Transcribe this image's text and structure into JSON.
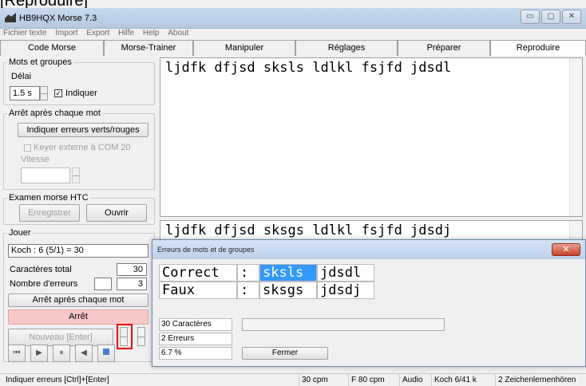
{
  "caption": "[Reproduire]",
  "window": {
    "title": "HB9HQX Morse 7.3",
    "minimize": "▭",
    "maximize": "▢",
    "close": "✕"
  },
  "menu": [
    "Fichier texte",
    "Import",
    "Export",
    "Hilfe",
    "Help",
    "About"
  ],
  "tabs": [
    "Code Morse",
    "Morse-Trainer",
    "Manipuler",
    "Réglages",
    "Préparer",
    "Reproduire"
  ],
  "left": {
    "mots_groupes": {
      "legend": "Mots et groupes",
      "delai_label": "Délai",
      "delai_value": "1.5 s",
      "indiquer_label": "Indiquer"
    },
    "arret": {
      "legend": "Arrêt après chaque mot",
      "btn_erreurs": "Indiquer erreurs verts/rouges",
      "keyer_label": "Keyer externe à COM 20",
      "vitesse_label": "Vitesse"
    },
    "examen": {
      "legend": "Examen morse HTC",
      "enregistrer": "Enregistrer",
      "ouvrir": "Ouvrir"
    },
    "jouer": {
      "legend": "Jouer",
      "koch_value": "Koch : 6 (5/1) = 30",
      "caracteres_label": "Caractères total",
      "caracteres_value": "30",
      "erreurs_label": "Nombre d'erreurs",
      "erreurs_value": "3",
      "arret_btn": "Arrêt après chaque mot",
      "arret_status": "Arrêt",
      "nouveau_btn": "Nouveau  [Enter]"
    }
  },
  "text": {
    "reference": "ljdfk dfjsd sksls ldlkl fsjfd jdsdl",
    "typed": "ljdfk dfjsd sksgs ldlkl fsjfd jdsdj"
  },
  "dialog": {
    "title": "Erreurs de mots et de groupes",
    "correct_label": "Correct",
    "faux_label": "Faux",
    "sep": ":",
    "correct_words": [
      "sksls",
      "jdsdl"
    ],
    "faux_words": [
      "sksgs",
      "jdsdj"
    ],
    "caracteres": "30 Caractères",
    "erreurs": "2 Erreurs",
    "percent": "6.7 %",
    "fermer": "Fermer"
  },
  "status": [
    "Indiquer erreurs  [Ctrl]+[Enter]",
    "30 cpm",
    "F 80 cpm",
    "Audio",
    "Koch 6/41  k",
    "2 Zeichenlernenhören"
  ],
  "colors": {
    "highlight": "#3399ff",
    "arret_bg": "#f8c8c8",
    "redbox": "#e00000"
  }
}
